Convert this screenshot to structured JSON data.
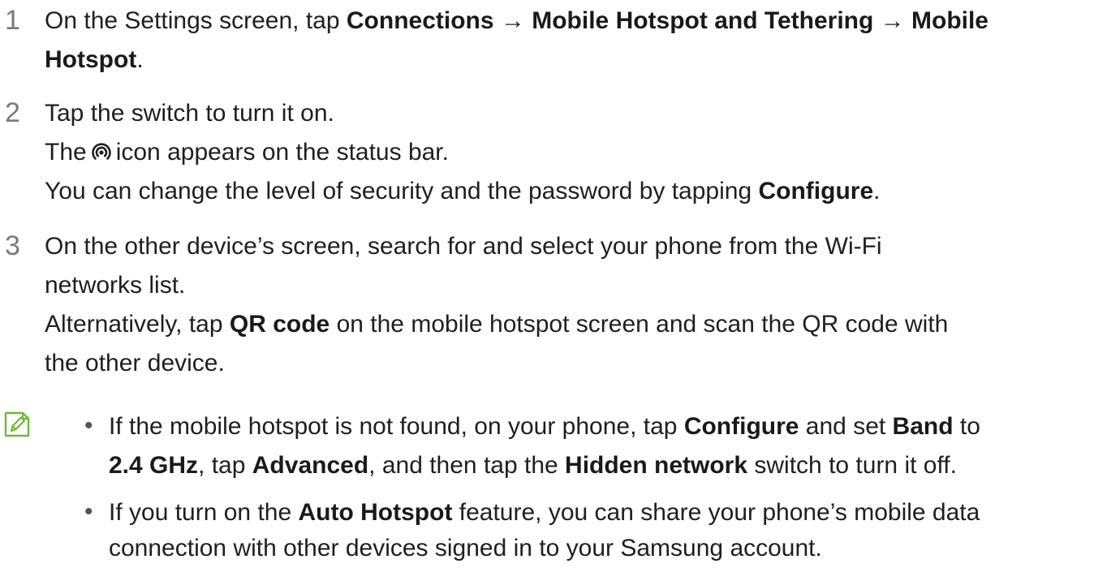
{
  "steps": [
    {
      "number": "1",
      "l1_a": "On the Settings screen, tap ",
      "l1_b": "Connections",
      "l1_c": " → ",
      "l1_d": "Mobile Hotspot and Tethering",
      "l1_e": " → ",
      "l1_f": "Mobile",
      "l2_a": "Hotspot",
      "l2_b": "."
    },
    {
      "number": "2",
      "l1": "Tap the switch to turn it on.",
      "l2_a": "The",
      "l2_icon": "mobile-hotspot-icon",
      "l2_b": "icon appears on the status bar.",
      "l3_a": "You can change the level of security and the password by tapping ",
      "l3_b": "Configure",
      "l3_c": "."
    },
    {
      "number": "3",
      "l1": "On the other device’s screen, search for and select your phone from the Wi-Fi",
      "l2": "networks list.",
      "l3_a": "Alternatively, tap ",
      "l3_b": "QR code",
      "l3_c": " on the mobile hotspot screen and scan the QR code with",
      "l4": "the other device."
    }
  ],
  "note": {
    "icon": "note-pencil-icon",
    "bullet": "•",
    "b1_l1_a": "If the mobile hotspot is not found, on your phone, tap ",
    "b1_l1_b": "Configure",
    "b1_l1_c": " and set ",
    "b1_l1_d": "Band",
    "b1_l1_e": " to",
    "b1_l2_a": "2.4 GHz",
    "b1_l2_b": ", tap ",
    "b1_l2_c": "Advanced",
    "b1_l2_d": ", and then tap the ",
    "b1_l2_e": "Hidden network",
    "b1_l2_f": " switch to turn it off.",
    "b2_l1_a": "If you turn on the ",
    "b2_l1_b": "Auto Hotspot",
    "b2_l1_c": " feature, you can share your phone’s mobile data",
    "b2_l2": "connection with other devices signed in to your Samsung account."
  }
}
